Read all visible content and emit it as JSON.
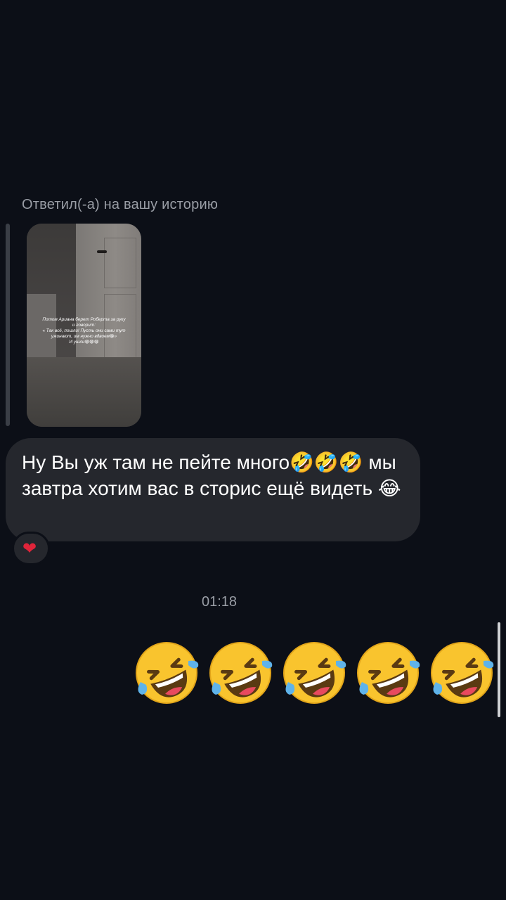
{
  "reply_context": {
    "label": "Ответил(-а) на вашу историю"
  },
  "story": {
    "caption_line1": "Потом Ариана берет Роберта за руку",
    "caption_line2": "и говорит:",
    "caption_line3": "« Так всё, пошли! Пусть они сами тут",
    "caption_line4": "ужинают, им нужно вдвоем😁»",
    "caption_line5": "И ушли😁😁😁"
  },
  "incoming_message": {
    "text": "Ну Вы уж там не пейте много🤣🤣🤣 мы завтра хотим вас в сторис ещё видеть 😂",
    "reaction": "heart"
  },
  "timestamp": "01:18",
  "outgoing_message": {
    "emojis": [
      "rolling-on-floor-laughing",
      "rolling-on-floor-laughing",
      "rolling-on-floor-laughing",
      "rolling-on-floor-laughing",
      "rolling-on-floor-laughing"
    ]
  },
  "colors": {
    "background": "#0c0f17",
    "bubble": "#25272d",
    "secondary_text": "#9a9ea6",
    "heart": "#e0243a"
  }
}
